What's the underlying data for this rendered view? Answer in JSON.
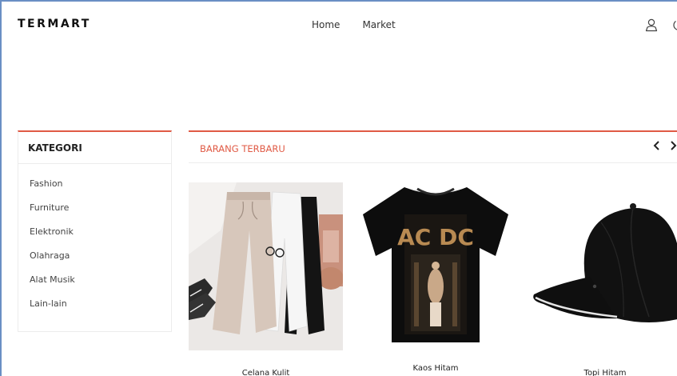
{
  "header": {
    "brand": "TERMART",
    "nav": [
      "Home",
      "Market"
    ],
    "icons": [
      "user-icon",
      "power-icon"
    ]
  },
  "categories": {
    "title": "KATEGORI",
    "items": [
      "Fashion",
      "Furniture",
      "Elektronik",
      "Olahraga",
      "Alat Musik",
      "Lain-lain"
    ]
  },
  "latest": {
    "title": "BARANG TERBARU",
    "prev_icon": "chevron-left-icon",
    "next_icon": "chevron-right-icon",
    "products": [
      {
        "name": "Celana Kulit"
      },
      {
        "name": "Kaos Hitam"
      },
      {
        "name": "Topi Hitam"
      }
    ]
  },
  "colors": {
    "accent": "#e05a45",
    "frame": "#6a8fc4"
  }
}
